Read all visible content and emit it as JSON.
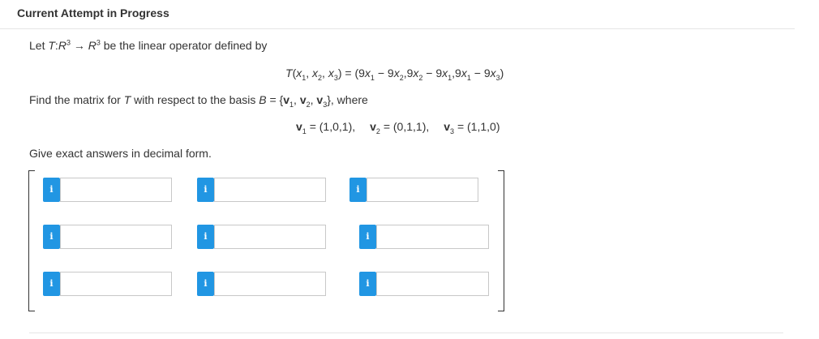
{
  "header": {
    "title": "Current Attempt in Progress"
  },
  "question": {
    "intro_prefix": "Let ",
    "intro_T": "T",
    "intro_colon": ":",
    "intro_R1": "R",
    "intro_exp1": "3",
    "intro_arrow": " → ",
    "intro_R2": "R",
    "intro_exp2": "3",
    "intro_suffix": " be the linear operator defined by",
    "transform": {
      "T": "T",
      "p1": "(",
      "x1": "x",
      "s1": "1",
      "c1": ", ",
      "x2": "x",
      "s2": "2",
      "c2": ", ",
      "x3": "x",
      "s3": "3",
      "p2": ") = (9",
      "x4": "x",
      "s4": "1",
      "m1": " − 9",
      "x5": "x",
      "s5": "2",
      "k1": ",9",
      "x6": "x",
      "s6": "2",
      "m2": " − 9",
      "x7": "x",
      "s7": "1",
      "k2": ",9",
      "x8": "x",
      "s8": "1",
      "m3": " − 9",
      "x9": "x",
      "s9": "3",
      "p3": ")"
    },
    "find_prefix": "Find the matrix for ",
    "find_T": "T",
    "find_mid": " with respect to the basis ",
    "find_B": "B",
    "find_eq": " = {",
    "find_v1": "v",
    "find_v1s": "1",
    "find_c1": ", ",
    "find_v2": "v",
    "find_v2s": "2",
    "find_c2": ", ",
    "find_v3": "v",
    "find_v3s": "3",
    "find_suffix": "}, where",
    "vectors": {
      "v1": "v",
      "v1s": "1",
      "v1val": " = (1,0,1),",
      "v2": "v",
      "v2s": "2",
      "v2val": " = (0,1,1),",
      "v3": "v",
      "v3s": "3",
      "v3val": " = (1,1,0)"
    },
    "instruction": "Give exact answers in decimal form."
  },
  "matrix": {
    "info_icon_glyph": "i",
    "accent_color": "#2196e3",
    "rows": [
      [
        {
          "value": "",
          "placeholder": ""
        },
        {
          "value": "",
          "placeholder": ""
        },
        {
          "value": "",
          "placeholder": ""
        }
      ],
      [
        {
          "value": "",
          "placeholder": ""
        },
        {
          "value": "",
          "placeholder": ""
        },
        {
          "value": "",
          "placeholder": ""
        }
      ],
      [
        {
          "value": "",
          "placeholder": ""
        },
        {
          "value": "",
          "placeholder": ""
        },
        {
          "value": "",
          "placeholder": ""
        }
      ]
    ]
  }
}
